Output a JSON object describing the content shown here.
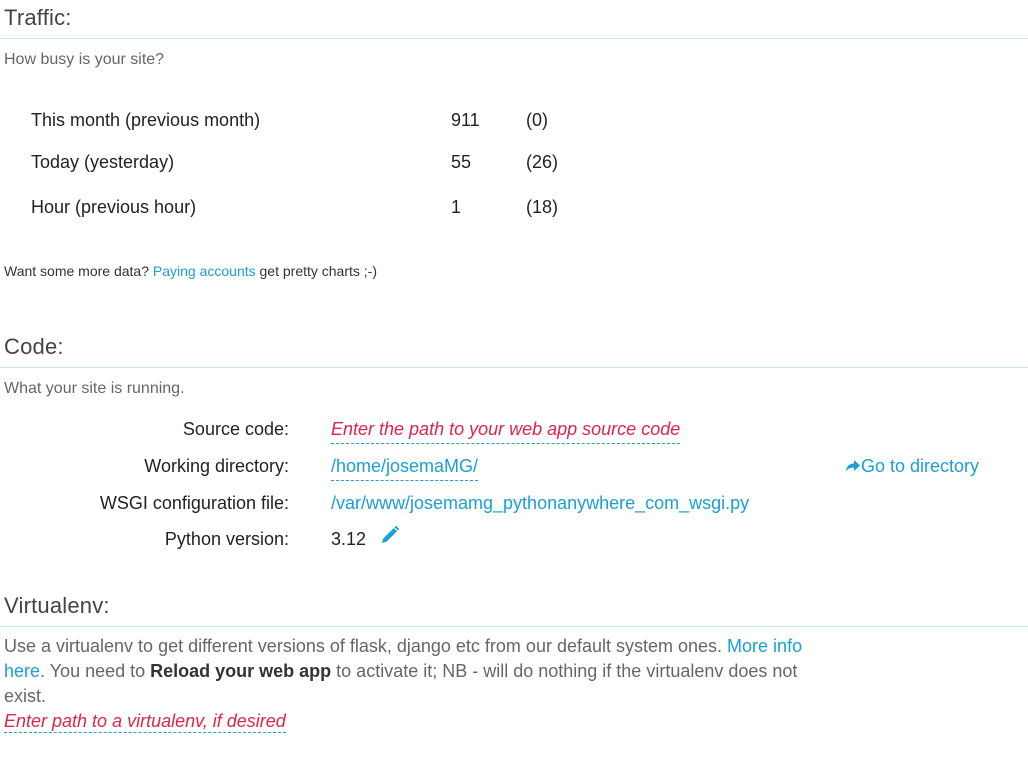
{
  "traffic": {
    "title": "Traffic:",
    "description": "How busy is your site?",
    "rows": [
      {
        "label": "This month (previous month)",
        "value": "911",
        "previous": "(0)"
      },
      {
        "label": "Today (yesterday)",
        "value": "55",
        "previous": "(26)"
      },
      {
        "label": "Hour (previous hour)",
        "value": "1",
        "previous": "(18)"
      }
    ],
    "more_data_prefix": "Want some more data? ",
    "more_data_link": "Paying accounts",
    "more_data_suffix": " get pretty charts ;-)"
  },
  "code": {
    "title": "Code:",
    "description": "What your site is running.",
    "source_code_label": "Source code:",
    "source_code_placeholder": "Enter the path to your web app source code",
    "working_directory_label": "Working directory:",
    "working_directory_value": "/home/josemaMG/",
    "go_to_directory_label": "Go to directory",
    "wsgi_label": "WSGI configuration file:",
    "wsgi_value": "/var/www/josemamg_pythonanywhere_com_wsgi.py",
    "python_version_label": "Python version:",
    "python_version_value": "3.12"
  },
  "virtualenv": {
    "title": "Virtualenv:",
    "desc_part1": "Use a virtualenv to get different versions of flask, django etc from our default system ones. ",
    "more_info_link": "More info here",
    "desc_part2": ". You need to ",
    "reload_bold": "Reload your web app",
    "desc_part3": " to activate it; NB - will do nothing if the virtualenv does not exist.",
    "path_placeholder": "Enter path to a virtualenv, if desired"
  },
  "colors": {
    "accent": "#1a9fd6",
    "placeholder": "#e0254d",
    "rule": "#cfe6f0"
  }
}
